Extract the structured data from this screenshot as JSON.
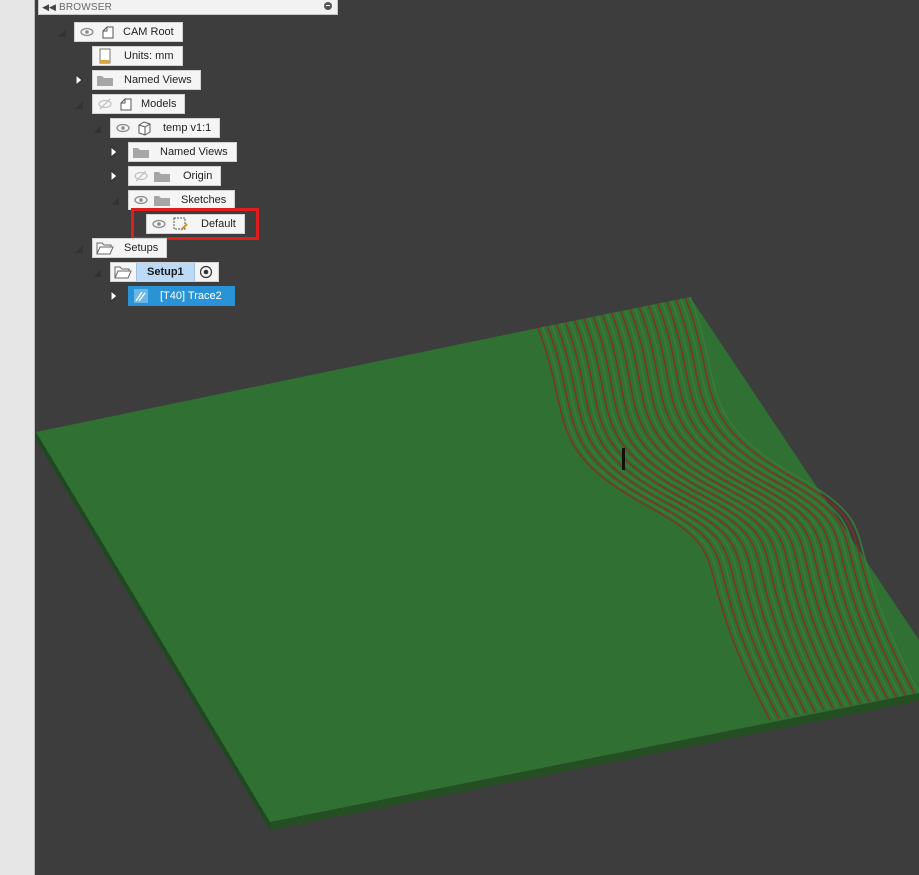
{
  "browser": {
    "title": "BROWSER",
    "collapse_glyph": "◀◀",
    "tree": {
      "root": {
        "label": "CAM Root",
        "icon": "component-icon"
      },
      "units": {
        "label": "Units: mm",
        "icon": "units-document-icon"
      },
      "named_views_top": {
        "label": "Named Views",
        "icon": "folder-icon"
      },
      "models": {
        "label": "Models",
        "icon": "component-icon"
      },
      "temp": {
        "label": "temp v1:1",
        "icon": "body-icon"
      },
      "named_views_inner": {
        "label": "Named Views",
        "icon": "folder-icon"
      },
      "origin": {
        "label": "Origin",
        "icon": "folder-icon"
      },
      "sketches": {
        "label": "Sketches",
        "icon": "folder-icon"
      },
      "default_sketch": {
        "label": "Default",
        "icon": "sketch-icon"
      },
      "setups": {
        "label": "Setups",
        "icon": "open-folder-icon"
      },
      "setup1": {
        "label": "Setup1",
        "icon": "open-folder-icon"
      },
      "trace": {
        "label": "[T40] Trace2",
        "icon": "toolpath-icon"
      }
    }
  },
  "colors": {
    "viewport_bg": "#3d3d3d",
    "stock_top": "#307032",
    "stock_edge": "#1f4d20",
    "toolpath_lines": "#8a2a1e",
    "selection_blue": "#2a93d5",
    "highlight_red": "#e01e1e"
  }
}
